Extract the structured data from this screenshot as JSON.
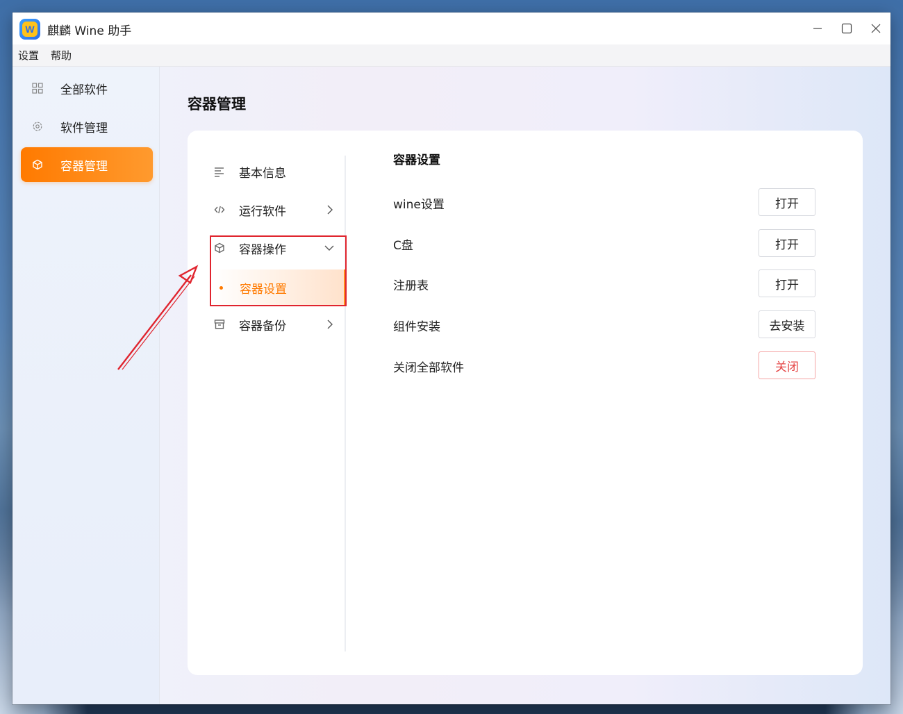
{
  "window": {
    "title": "麒麟 Wine 助手",
    "logo_letter": "W"
  },
  "menubar": {
    "items": [
      "设置",
      "帮助"
    ]
  },
  "sidebar": {
    "items": [
      {
        "label": "全部软件",
        "icon": "grid-icon",
        "active": false
      },
      {
        "label": "软件管理",
        "icon": "gear-icon",
        "active": false
      },
      {
        "label": "容器管理",
        "icon": "cube-icon",
        "active": true
      }
    ]
  },
  "page": {
    "title": "容器管理"
  },
  "subnav": {
    "items": [
      {
        "label": "基本信息",
        "icon": "list-icon"
      },
      {
        "label": "运行软件",
        "icon": "code-icon"
      },
      {
        "label": "容器操作",
        "icon": "cube-icon",
        "expanded": true
      },
      {
        "label": "容器备份",
        "icon": "archive-icon"
      }
    ],
    "active_child": "容器设置"
  },
  "panel": {
    "title": "容器设置",
    "rows": [
      {
        "label": "wine设置",
        "button": "打开"
      },
      {
        "label": "C盘",
        "button": "打开"
      },
      {
        "label": "注册表",
        "button": "打开"
      },
      {
        "label": "组件安装",
        "button": "去安装"
      },
      {
        "label": "关闭全部软件",
        "button": "关闭"
      }
    ]
  },
  "colors": {
    "accent": "#ff7a00",
    "highlight_box": "#e0242e",
    "danger": "#e54545"
  }
}
